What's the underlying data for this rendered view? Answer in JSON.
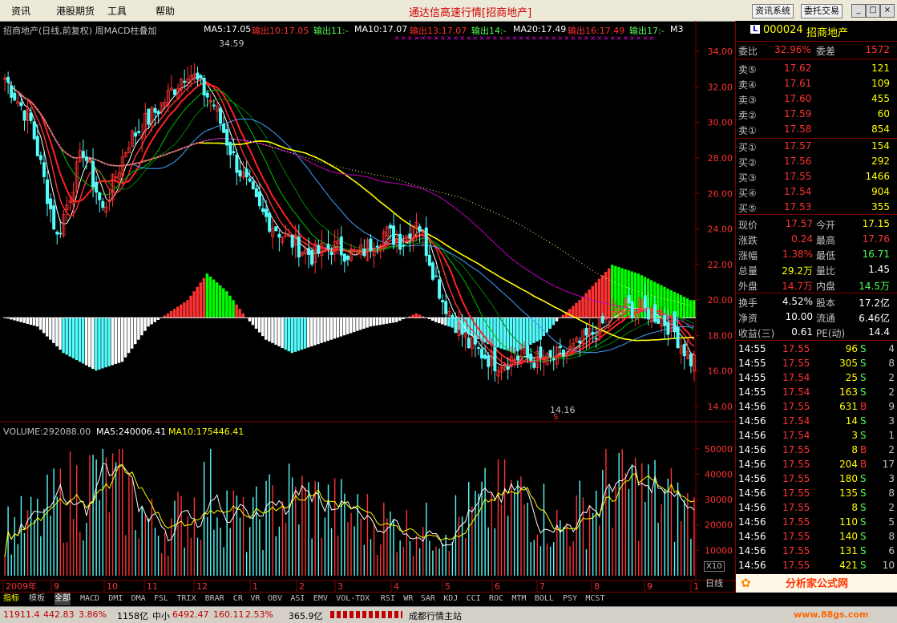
{
  "menubar": {
    "items": [
      "资讯",
      "港股期货",
      "工具",
      "帮助"
    ],
    "title": "通达信高速行情[招商地产]",
    "buttons": [
      "资讯系统",
      "委托交易"
    ],
    "win_buttons": [
      "_",
      "□",
      "×"
    ]
  },
  "header": {
    "name": "招商地产(日线,前复权) 周MACD柱叠加",
    "ma5": "MA5:17.05",
    "out10": "输出10:17.05",
    "out11": "输出11:-",
    "ma10": "MA10:17.07",
    "out13": "输出13:17.07",
    "out14": "输出14:-",
    "ma20": "MA20:17.49",
    "out16": "输出16:17.49",
    "out17": "输出17:-",
    "m3": "M3"
  },
  "volume_header": {
    "vol": "VOLUME:292088.00",
    "ma5": "MA5:240006.41",
    "ma10": "MA10:175446.41"
  },
  "labels": {
    "high": "34.59",
    "low": "14.16",
    "s_mark": "S",
    "x10": "X10",
    "rilines": "日线"
  },
  "colors": {
    "up": "#ff3232",
    "down": "#54fcfc",
    "ma5": "#ffffff",
    "ma10": "#ffff00",
    "ma20": "#ff00ff",
    "bg": "#000000",
    "grid": "#800000"
  },
  "chart_data": {
    "type": "candlestick",
    "price_axis": [
      34.0,
      32.0,
      30.0,
      28.0,
      26.0,
      24.0,
      22.0,
      20.0,
      18.0,
      16.0,
      14.0
    ],
    "volume_axis": [
      50000,
      40000,
      30000,
      20000,
      10000
    ],
    "x_axis": [
      "2009年",
      "9",
      "10",
      "11",
      "12",
      "1",
      "2",
      "3",
      "4",
      "5",
      "6",
      "7",
      "8",
      "9",
      "1"
    ],
    "high": 34.59,
    "low": 14.16,
    "price_anchor": [
      [
        0,
        32.5
      ],
      [
        8,
        30
      ],
      [
        16,
        23.5
      ],
      [
        24,
        28.5
      ],
      [
        30,
        25
      ],
      [
        38,
        29
      ],
      [
        48,
        31
      ],
      [
        56,
        33
      ],
      [
        64,
        31
      ],
      [
        70,
        28
      ],
      [
        78,
        25
      ],
      [
        86,
        23.5
      ],
      [
        94,
        22.5
      ],
      [
        100,
        23
      ],
      [
        108,
        22.5
      ],
      [
        116,
        23.8
      ],
      [
        122,
        23.3
      ],
      [
        126,
        24.7
      ],
      [
        134,
        20
      ],
      [
        142,
        17.5
      ],
      [
        150,
        16.5
      ],
      [
        158,
        16.8
      ],
      [
        166,
        16.5
      ],
      [
        174,
        17.2
      ],
      [
        182,
        18.5
      ],
      [
        190,
        19.6
      ],
      [
        198,
        19.3
      ],
      [
        204,
        18.5
      ],
      [
        210,
        16.6
      ]
    ],
    "macd_anchor": [
      [
        0,
        0
      ],
      [
        10,
        -2
      ],
      [
        18,
        -8
      ],
      [
        28,
        -12
      ],
      [
        36,
        -10
      ],
      [
        44,
        -2
      ],
      [
        50,
        1
      ],
      [
        56,
        4
      ],
      [
        62,
        10
      ],
      [
        68,
        6
      ],
      [
        74,
        0
      ],
      [
        80,
        -5
      ],
      [
        88,
        -8
      ],
      [
        96,
        -6
      ],
      [
        104,
        -4
      ],
      [
        112,
        -2
      ],
      [
        120,
        -1
      ],
      [
        126,
        1
      ],
      [
        132,
        -1
      ],
      [
        140,
        -3
      ],
      [
        148,
        -6
      ],
      [
        156,
        -8
      ],
      [
        164,
        -5
      ],
      [
        170,
        0
      ],
      [
        176,
        4
      ],
      [
        186,
        12
      ],
      [
        194,
        10
      ],
      [
        202,
        7
      ],
      [
        210,
        4
      ]
    ]
  },
  "right_panel": {
    "code": "000024",
    "name": "招商地产",
    "weibi": {
      "label": "委比",
      "value": "32.96%",
      "label2": "委差",
      "value2": "1572"
    },
    "asks": [
      {
        "label": "卖⑤",
        "price": "17.62",
        "vol": "121"
      },
      {
        "label": "卖④",
        "price": "17.61",
        "vol": "109"
      },
      {
        "label": "卖③",
        "price": "17.60",
        "vol": "455"
      },
      {
        "label": "卖②",
        "price": "17.59",
        "vol": "60"
      },
      {
        "label": "卖①",
        "price": "17.58",
        "vol": "854"
      }
    ],
    "bids": [
      {
        "label": "买①",
        "price": "17.57",
        "vol": "154"
      },
      {
        "label": "买②",
        "price": "17.56",
        "vol": "292"
      },
      {
        "label": "买③",
        "price": "17.55",
        "vol": "1466"
      },
      {
        "label": "买④",
        "price": "17.54",
        "vol": "904"
      },
      {
        "label": "买⑤",
        "price": "17.53",
        "vol": "355"
      }
    ],
    "quote": [
      {
        "l1": "现价",
        "v1": "17.57",
        "c1": "#ff3232",
        "l2": "今开",
        "v2": "17.15",
        "c2": "#ffff00"
      },
      {
        "l1": "涨跌",
        "v1": "0.24",
        "c1": "#ff3232",
        "l2": "最高",
        "v2": "17.76",
        "c2": "#ff3232"
      },
      {
        "l1": "涨幅",
        "v1": "1.38%",
        "c1": "#ff3232",
        "l2": "最低",
        "v2": "16.71",
        "c2": "#54fc54"
      },
      {
        "l1": "总量",
        "v1": "29.2万",
        "c1": "#ffff00",
        "l2": "量比",
        "v2": "1.45",
        "c2": "#ffffff"
      },
      {
        "l1": "外盘",
        "v1": "14.7万",
        "c1": "#ff3232",
        "l2": "内盘",
        "v2": "14.5万",
        "c2": "#54fc54"
      }
    ],
    "stats": [
      {
        "l1": "换手",
        "v1": "4.52%",
        "l2": "股本",
        "v2": "17.2亿"
      },
      {
        "l1": "净资",
        "v1": "10.00",
        "l2": "流通",
        "v2": "6.46亿"
      },
      {
        "l1": "收益(三)",
        "v1": "0.61",
        "l2": "PE(动)",
        "v2": "14.4"
      }
    ],
    "ticks": [
      {
        "time": "14:55",
        "price": "17.55",
        "vol": "96",
        "bs": "S",
        "n": "4"
      },
      {
        "time": "14:55",
        "price": "17.55",
        "vol": "305",
        "bs": "S",
        "n": "8"
      },
      {
        "time": "14:55",
        "price": "17.54",
        "vol": "25",
        "bs": "S",
        "n": "2"
      },
      {
        "time": "14:55",
        "price": "17.54",
        "vol": "163",
        "bs": "S",
        "n": "2"
      },
      {
        "time": "14:56",
        "price": "17.55",
        "vol": "631",
        "bs": "B",
        "n": "9"
      },
      {
        "time": "14:56",
        "price": "17.54",
        "vol": "14",
        "bs": "S",
        "n": "3"
      },
      {
        "time": "14:56",
        "price": "17.54",
        "vol": "3",
        "bs": "S",
        "n": "1"
      },
      {
        "time": "14:56",
        "price": "17.55",
        "vol": "8",
        "bs": "B",
        "n": "2"
      },
      {
        "time": "14:56",
        "price": "17.55",
        "vol": "204",
        "bs": "B",
        "n": "17"
      },
      {
        "time": "14:56",
        "price": "17.55",
        "vol": "180",
        "bs": "S",
        "n": "3"
      },
      {
        "time": "14:56",
        "price": "17.55",
        "vol": "135",
        "bs": "S",
        "n": "8"
      },
      {
        "time": "14:56",
        "price": "17.55",
        "vol": "8",
        "bs": "S",
        "n": "2"
      },
      {
        "time": "14:56",
        "price": "17.55",
        "vol": "110",
        "bs": "S",
        "n": "5"
      },
      {
        "time": "14:56",
        "price": "17.55",
        "vol": "140",
        "bs": "S",
        "n": "8"
      },
      {
        "time": "14:56",
        "price": "17.55",
        "vol": "131",
        "bs": "S",
        "n": "6"
      },
      {
        "time": "14:56",
        "price": "17.55",
        "vol": "421",
        "bs": "S",
        "n": "10"
      }
    ]
  },
  "tabs": [
    "指标",
    "模板",
    "全部",
    "MACD",
    "DMI",
    "DMA",
    "FSL",
    "TRIX",
    "BRAR",
    "CR",
    "VR",
    "OBV",
    "ASI",
    "EMV",
    "VOL-TDX",
    "RSI",
    "WR",
    "SAR",
    "KDJ",
    "CCI",
    "ROC",
    "MTM",
    "BOLL",
    "PSY",
    "MCST"
  ],
  "status": {
    "sh": "11911.4",
    "sh_chg": "442.83",
    "sh_pct": "3.86%",
    "sh_amt": "1158亿",
    "sz_label": "中小",
    "sz": "6492.47",
    "sz_chg": "160.11",
    "sz_pct": "2.53%",
    "sz_amt": "365.9亿",
    "station": "成都行情主站",
    "watermark": "分析家公式网",
    "url": "www.88gs.com"
  }
}
